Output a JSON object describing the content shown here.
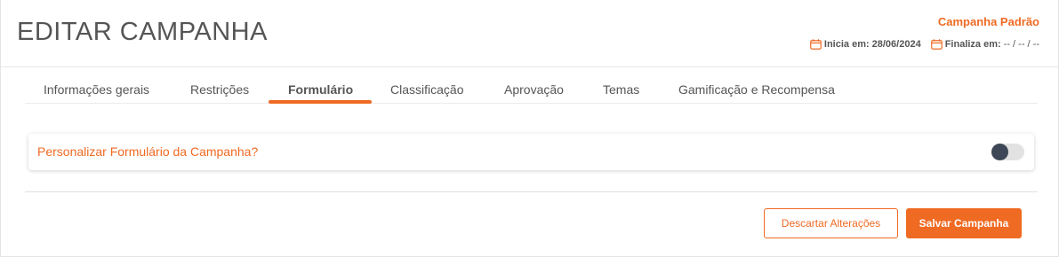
{
  "header": {
    "title": "EDITAR CAMPANHA",
    "campaign_name": "Campanha Padrão",
    "start_label": "Inicia em:",
    "start_value": "28/06/2024",
    "end_label": "Finaliza em:",
    "end_value": "-- / -- / --",
    "calendar_icon": "calendar-icon"
  },
  "tabs": [
    {
      "label": "Informações gerais",
      "active": false
    },
    {
      "label": "Restrições",
      "active": false
    },
    {
      "label": "Formulário",
      "active": true
    },
    {
      "label": "Classificação",
      "active": false
    },
    {
      "label": "Aprovação",
      "active": false
    },
    {
      "label": "Temas",
      "active": false
    },
    {
      "label": "Gamificação e Recompensa",
      "active": false
    }
  ],
  "form_section": {
    "question": "Personalizar Formulário da Campanha?",
    "toggle_on": false
  },
  "actions": {
    "discard_label": "Descartar Alterações",
    "save_label": "Salvar Campanha"
  },
  "colors": {
    "accent": "#ef6a23",
    "text": "#555555",
    "toggle_knob": "#3e4756",
    "toggle_track": "#e2e2e2"
  }
}
